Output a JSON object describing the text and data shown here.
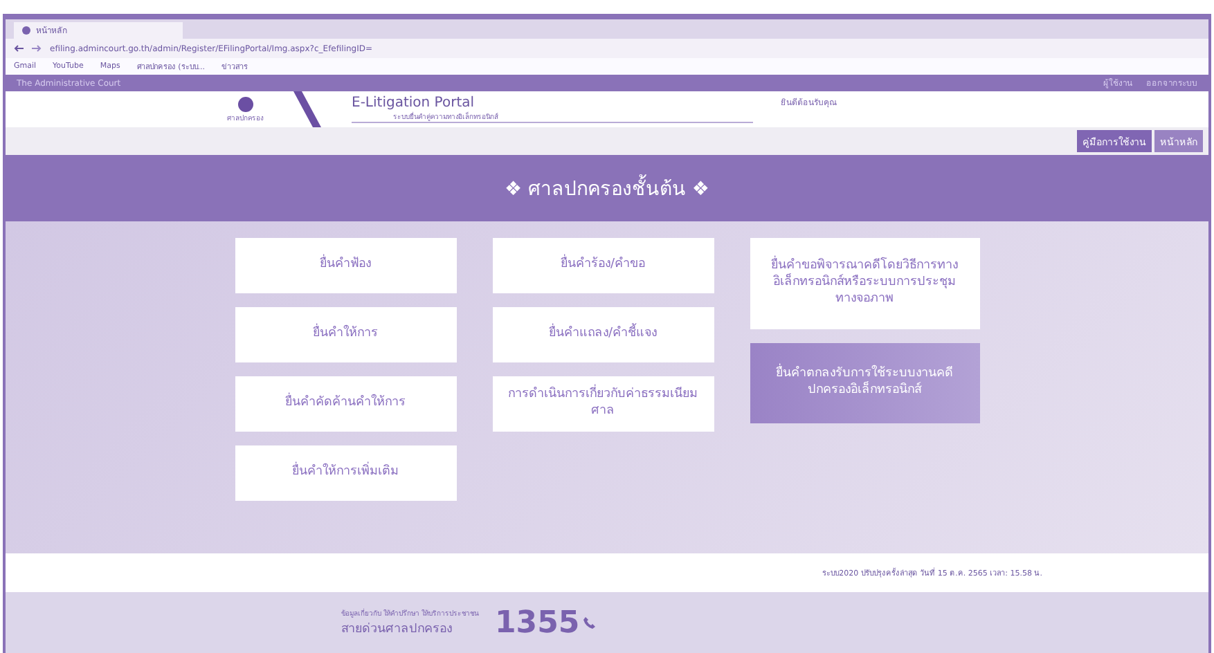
{
  "browser": {
    "tab_title": "หน้าหลัก",
    "url": "efiling.admincourt.go.th/admin/Register/EFilingPortal/Img.aspx?c_EfefilingID=",
    "bookmarks": [
      "Gmail",
      "YouTube",
      "Maps",
      "ศาลปกครอง (ระบบ...",
      "ข่าวสาร"
    ]
  },
  "site_bar": {
    "title": "The Administrative Court",
    "user": "ผู้ใช้งาน",
    "logout": "ออกจากระบบ"
  },
  "header": {
    "logo_caption": "ศาลปกครอง",
    "portal_title": "E-Litigation Portal",
    "portal_subtitle": "ระบบยื่นคำคู่ความทางอิเล็กทรอนิกส์",
    "welcome": "ยินดีต้อนรับคุณ"
  },
  "nav": [
    {
      "label": "คู่มือการใช้งาน",
      "selected": true
    },
    {
      "label": "หน้าหลัก",
      "selected": false
    }
  ],
  "page_title": "❖ ศาลปกครองชั้นต้น ❖",
  "actions": [
    {
      "label": "ยื่นคำฟ้อง",
      "selected": false
    },
    {
      "label": "ยื่นคำร้อง/คำขอ",
      "selected": false
    },
    {
      "label": "ยื่นคำขอพิจารณาคดีโดยวิธีการทางอิเล็กทรอนิกส์หรือระบบการประชุมทางจอภาพ",
      "selected": false
    },
    {
      "label": "ยื่นคำให้การ",
      "selected": false
    },
    {
      "label": "ยื่นคำแถลง/คำชี้แจง",
      "selected": false
    },
    {
      "label": "ยื่นคำตกลงรับการใช้ระบบงานคดีปกครองอิเล็กทรอนิกส์",
      "selected": true
    },
    {
      "label": "ยื่นคำคัดค้านคำให้การ",
      "selected": false
    },
    {
      "label": "การดำเนินการเกี่ยวกับค่าธรรมเนียมศาล",
      "selected": false
    },
    {
      "label": "ยื่นคำให้การเพิ่มเติม",
      "selected": false
    }
  ],
  "update_note": "ระบบ2020 ปรับปรุงครั้งล่าสุด วันที่ 15 ต.ค. 2565 เวลา: 15.58 น.",
  "hotline": {
    "caption": "ข้อมูลเกี่ยวกับ ให้คำปรึกษา ให้บริการประชาชน",
    "name": "สายด่วนศาลปกครอง",
    "number": "1355"
  }
}
